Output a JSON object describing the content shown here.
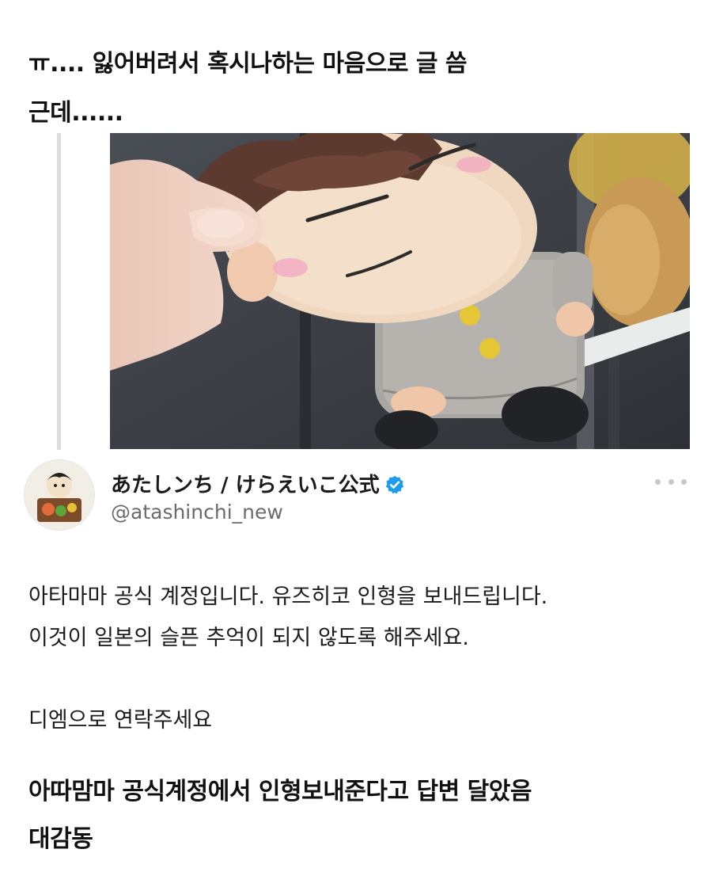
{
  "post": {
    "intro_line_1": "ㅠ.... 잃어버려서 혹시나하는 마음으로 글 씀",
    "intro_line_2": "근데......"
  },
  "photo": {
    "description_icon": "plush-doll-photo"
  },
  "quoted_tweet": {
    "display_name": "あたしンち / けらえいこ公式",
    "handle": "@atashinchi_new",
    "verified_icon": "verified-badge-icon",
    "menu_icon": "more-options-icon",
    "body_line_1": "아타마마 공식 계정입니다. 유즈히코 인형을 보내드립니다.",
    "body_line_2": "이것이 일본의 슬픈 추억이 되지 않도록 해주세요.",
    "body_line_3": "디엠으로 연락주세요"
  },
  "outro": {
    "line_1": "아따맘마 공식계정에서 인형보내준다고 답변 달았음",
    "line_2": "대감동"
  },
  "colors": {
    "verified": "#1d9bf0",
    "text": "#111111",
    "handle": "#6b6b6b",
    "quote_bar": "#dcdcdc"
  }
}
